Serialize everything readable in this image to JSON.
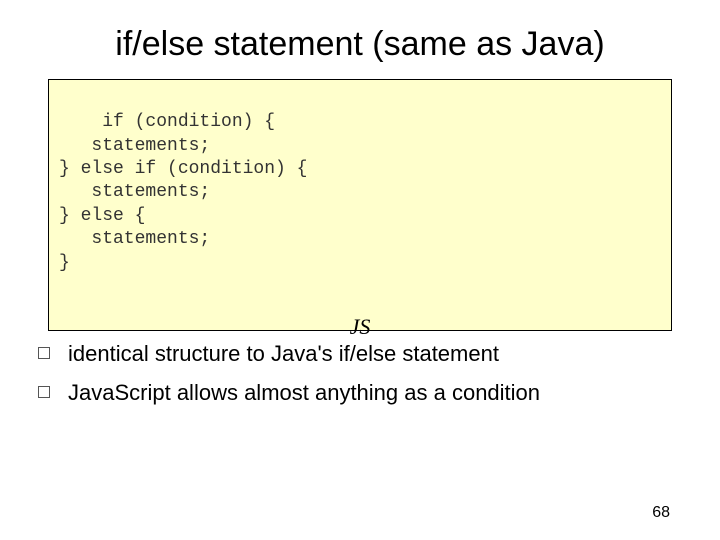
{
  "title": "if/else statement (same as Java)",
  "code": "if (condition) {\n   statements;\n} else if (condition) {\n   statements;\n} else {\n   statements;\n}",
  "codeLabel": "JS",
  "bullets": [
    "identical structure to Java's if/else statement",
    "JavaScript allows almost anything as a condition"
  ],
  "pageNumber": "68"
}
